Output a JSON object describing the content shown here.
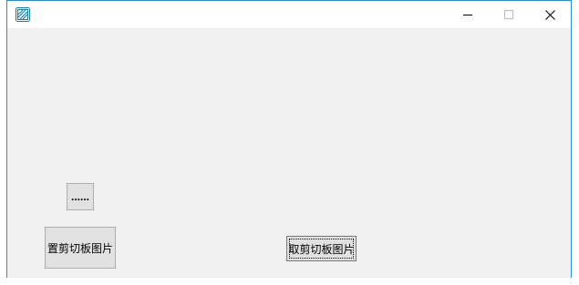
{
  "window": {
    "icon": "app-icon",
    "controls": {
      "minimize_icon": "minimize-icon",
      "maximize_icon": "maximize-icon",
      "close_icon": "close-icon"
    }
  },
  "buttons": {
    "dots_label": "......",
    "set_clipboard_label": "置剪切板图片",
    "get_clipboard_label": "取剪切板图片"
  },
  "colors": {
    "window_border": "#2b8fc9",
    "client_background": "#f0f0f0",
    "button_face": "#e1e1e1"
  }
}
